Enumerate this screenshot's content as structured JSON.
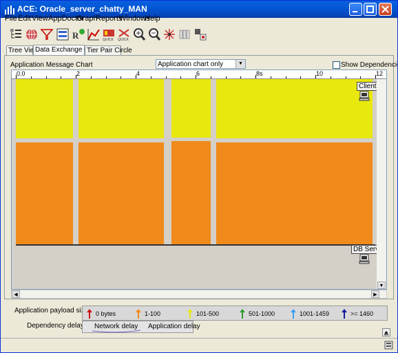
{
  "window": {
    "title": "ACE: Oracle_server_chatty_MAN"
  },
  "menu": [
    "File",
    "Edit",
    "View",
    "AppDoctor",
    "Graph",
    "Reports",
    "Windows",
    "Help"
  ],
  "toolbar": [
    "tree-view-icon",
    "globe-icon",
    "filter-icon",
    "tiers-icon",
    "appdoctor-rx-icon",
    "chart-icon",
    "quick-chart-icon",
    "quick-chart-2-icon",
    "zoom-in-icon",
    "zoom-out-icon",
    "spider-icon",
    "tiles-icon",
    "export-icon"
  ],
  "tabs": [
    "Tree View",
    "Data Exchange Chart",
    "Tier Pair Circle"
  ],
  "chart_header": {
    "label": "Application Message Chart",
    "select_value": "Application chart only",
    "checkbox_label": "Show Dependencies"
  },
  "ruler": {
    "labels": [
      "0.0",
      "2",
      "4",
      "6",
      "8s",
      "10",
      "12"
    ]
  },
  "nodes": {
    "client": "Client",
    "server": "DB Server"
  },
  "chart_data": {
    "type": "bar",
    "x_unit": "s",
    "xlim": [
      0,
      12
    ],
    "bars": [
      {
        "start": 0.0,
        "end": 1.9,
        "upper_color": "#E8E80E",
        "lower_color": "#F08A1A"
      },
      {
        "start": 2.1,
        "end": 4.95,
        "upper_color": "#E8E80E",
        "lower_color": "#F08A1A"
      },
      {
        "start": 5.2,
        "end": 6.5,
        "upper_color": "#E8E80E",
        "lower_color": "#F08A1A"
      },
      {
        "start": 6.7,
        "end": 11.9,
        "upper_color": "#E8E80E",
        "lower_color": "#F08A1A"
      }
    ]
  },
  "footer": {
    "payload_label": "Application payload size:",
    "payload_legend": [
      {
        "label": "0 bytes",
        "color": "#CC1010"
      },
      {
        "label": "1-100",
        "color": "#F08A1A"
      },
      {
        "label": "101-500",
        "color": "#E8E80E"
      },
      {
        "label": "501-1000",
        "color": "#2E9A2E"
      },
      {
        "label": "1001-1459",
        "color": "#3A9CF0"
      },
      {
        "label": ">= 1460",
        "color": "#101A9A"
      }
    ],
    "dependency_label": "Dependency delays:",
    "network_delay": "Network delay",
    "application_delay": "Application delay"
  }
}
